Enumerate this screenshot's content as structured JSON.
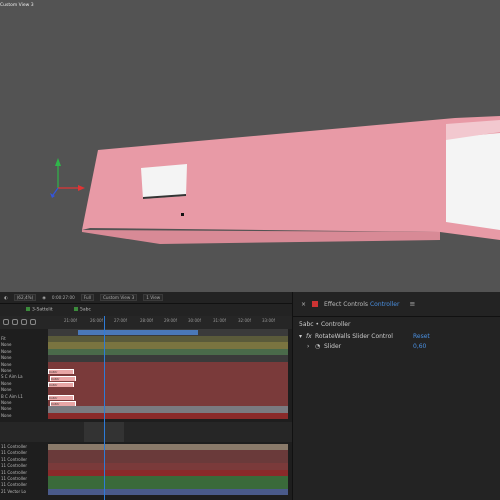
{
  "viewport": {
    "label": "Custom View 3"
  },
  "composition_toolbar": {
    "zoom": "(62,4%)",
    "timecode": "0:00:27:00",
    "resolution": "Full",
    "view": "Custom View 3",
    "views": "1 View"
  },
  "timeline": {
    "tabs": [
      {
        "label": "3-Sattelit"
      },
      {
        "label": "5abc"
      }
    ],
    "ruler_ticks": [
      "21:00f",
      "26:00f",
      "27:00f",
      "28:00f",
      "29:00f",
      "30:00f",
      "31:00f",
      "32:00f",
      "33:00f"
    ],
    "layer_modes": [
      "Fit",
      "None",
      "None",
      "None",
      "None",
      "None",
      "S C Aim La",
      "None",
      "None",
      "B C Aim L1",
      "None",
      "None",
      "None"
    ],
    "controllers": [
      "11 Controller",
      "11 Controller",
      "11 Controller",
      "11 Controller",
      "11 Controller",
      "11 Controller",
      "11 Controller",
      "21 Vector Lo"
    ],
    "marker_label": "Cntrlr",
    "colors": {
      "playhead": "#2d7bd8",
      "accent": "#4a90e2"
    }
  },
  "effects": {
    "panel_title": "Effect Controls",
    "panel_target": "Controller",
    "comp_path": "5abc • Controller",
    "effect_name": "RotateWalls Slider Control",
    "reset_label": "Reset",
    "param_name": "Slider",
    "param_value": "0,60"
  }
}
